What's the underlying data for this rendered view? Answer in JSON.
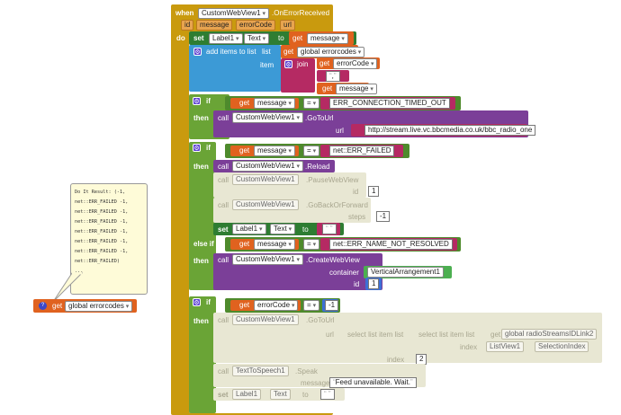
{
  "event": {
    "when": "when",
    "component": "CustomWebView1",
    "event": ".OnErrorReceived",
    "params": [
      "id",
      "message",
      "errorCode",
      "url"
    ],
    "do": "do"
  },
  "set1": {
    "set": "set",
    "comp": "Label1",
    "prop": "Text",
    "to": "to",
    "get": "get",
    "var": "message"
  },
  "add": {
    "title": "add items to list",
    "list_lbl": "list",
    "get": "get",
    "list_var": "global errorcodes",
    "item_lbl": "item",
    "join": "join",
    "get_err": "get",
    "err_var": "errorCode",
    "sep": ",",
    "get_msg": "get",
    "msg_var": "message"
  },
  "if1": {
    "if": "if",
    "get": "get",
    "var": "message",
    "eq": "=",
    "str": "ERR_CONNECTION_TIMED_OUT",
    "then": "then",
    "call": "call",
    "comp": "CustomWebView1",
    "method": ".GoToUrl",
    "url_lbl": "url",
    "url": "http://stream.live.vc.bbcmedia.co.uk/bbc_radio_one"
  },
  "if2": {
    "if": "if",
    "get": "get",
    "var": "message",
    "eq": "=",
    "str": "net::ERR_FAILED",
    "then": "then",
    "call1": "call",
    "comp1": "CustomWebView1",
    "method1": ".Reload",
    "call2": "call",
    "comp2": "CustomWebView1",
    "method2": ".PauseWebView",
    "id_lbl": "id",
    "id_val": "1",
    "call3": "call",
    "comp3": "CustomWebView1",
    "method3": ".GoBackOrForward",
    "steps_lbl": "steps",
    "steps_val": "-1",
    "set": "set",
    "set_comp": "Label1",
    "set_prop": "Text",
    "set_to": "to",
    "set_str": " ",
    "elseif": "else if",
    "get2": "get",
    "var2": "message",
    "eq2": "=",
    "str2": "net::ERR_NAME_NOT_RESOLVED",
    "then2": "then",
    "call4": "call",
    "comp4": "CustomWebView1",
    "method4": ".CreateWebView",
    "container_lbl": "container",
    "container_val": "VerticalArrangement1",
    "id2_lbl": "id",
    "id2_val": "1"
  },
  "if3": {
    "if": "if",
    "get": "get",
    "var": "errorCode",
    "eq": "=",
    "num": "-1",
    "then": "then",
    "call1": "call",
    "comp1": "CustomWebView1",
    "method1": ".GoToUrl",
    "url_lbl": "url",
    "sel1": "select list item  list",
    "sel2": "select list item  list",
    "list_var": "global radioStreamsIDLink2",
    "index_lbl": "index",
    "lv": "ListView1",
    "lv_prop": "SelectionIndex",
    "index2_lbl": "index",
    "index2_val": "2",
    "call2": "call",
    "comp2": "TextToSpeech1",
    "method2": ".Speak",
    "message_lbl": "message",
    "speak_str": "Feed unavailable. Wait.",
    "set": "set",
    "set_comp": "Label1",
    "set_prop": "Text",
    "set_to": "to",
    "set_str": " "
  },
  "bubble": {
    "lines": [
      "Do It Result: (-1,",
      "net::ERR_FAILED -1,",
      "net::ERR_FAILED -1,",
      "net::ERR_FAILED -1,",
      "net::ERR_FAILED -1,",
      "net::ERR_FAILED -1,",
      "net::ERR_FAILED -1,",
      "net::ERR_FAILED)",
      "..."
    ]
  },
  "getblock": {
    "badge": "?",
    "get": "get",
    "var": "global errorcodes"
  },
  "colors": {
    "event": "#c99a0e",
    "set": "#2e7d32",
    "list": "#3c9ad6",
    "text": "#b52a63",
    "logic": "#6aa436",
    "compare": "#4e8a2c",
    "proc": "#7b3f98",
    "var": "#e0621f",
    "disabled": "#e8e7d3"
  }
}
